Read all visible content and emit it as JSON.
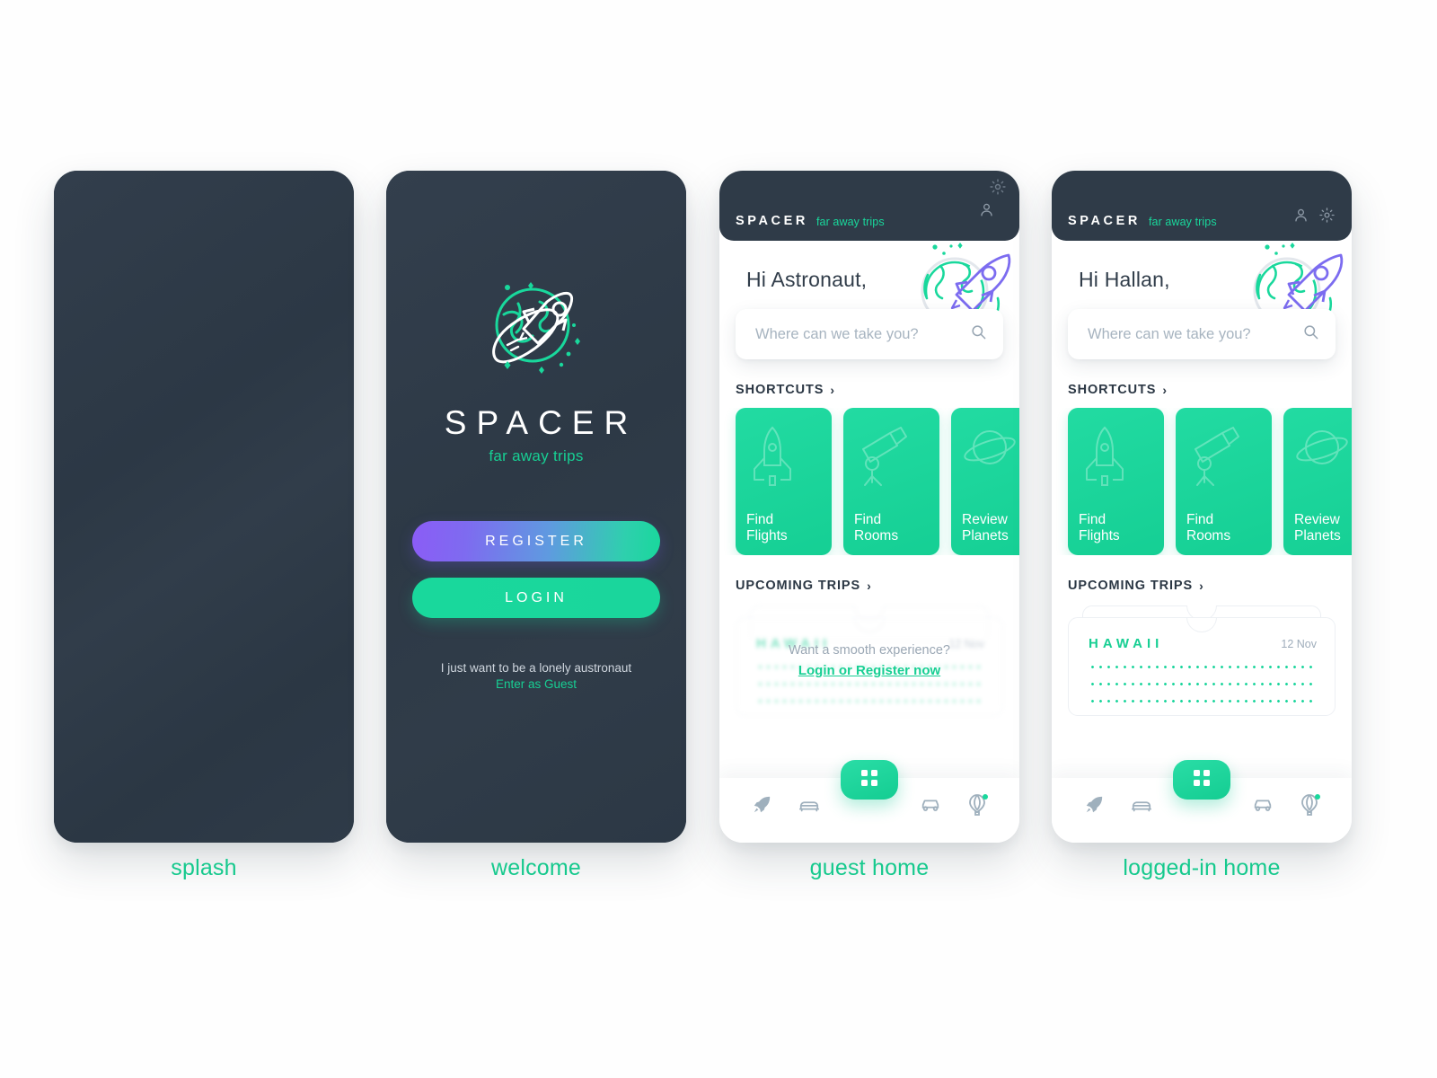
{
  "brand": {
    "name": "SPACER",
    "tagline": "far away trips"
  },
  "colors": {
    "accent_green": "#19d89c",
    "dark_navy": "#2f3b48",
    "purple": "#8b5cf6",
    "muted_text": "#a7b4c0",
    "caption_green": "#16c98d"
  },
  "captions": {
    "splash": "splash",
    "welcome": "welcome",
    "guest_home": "guest home",
    "logged_in_home": "logged-in home"
  },
  "welcome": {
    "logo_icon": "globe-rocket-logo-icon",
    "brand_name": "SPACER",
    "brand_sub": "far away trips",
    "register_label": "REGISTER",
    "login_label": "LOGIN",
    "guest_note_line1": "I just want to be a lonely austronaut",
    "guest_note_line2": "Enter as Guest"
  },
  "guest_home": {
    "app_bar": {
      "wordmark": "SPACER",
      "tagline": "far away trips",
      "person_icon": "person-icon",
      "gear_icon": "gear-icon"
    },
    "greeting": "Hi Astronaut,",
    "hero_icon": "globe-rocket-illustration-icon",
    "search": {
      "placeholder": "Where can we take you?",
      "value": "",
      "search_icon": "search-icon"
    },
    "shortcuts": {
      "title": "SHORTCUTS",
      "chevron": "›",
      "cards": [
        {
          "label": "Find\nFlights",
          "icon": "rocket-shuttle-icon"
        },
        {
          "label": "Find\nRooms",
          "icon": "telescope-icon"
        },
        {
          "label": "Review\nPlanets",
          "icon": "planet-icon"
        }
      ]
    },
    "upcoming_trips": {
      "title": "UPCOMING TRIPS",
      "chevron": "›",
      "hidden_destination": "HAWAII",
      "hidden_date": "12 Nov",
      "overlay_question": "Want a smooth experience?",
      "overlay_action": "Login or Register now"
    },
    "tabbar": {
      "items": [
        {
          "icon": "rocket-icon",
          "badge": false
        },
        {
          "icon": "bed-icon",
          "badge": false
        },
        {
          "icon": "grid-icon",
          "badge": false
        },
        {
          "icon": "car-icon",
          "badge": false
        },
        {
          "icon": "hot-air-balloon-icon",
          "badge": true
        }
      ]
    }
  },
  "logged_in_home": {
    "app_bar": {
      "wordmark": "SPACER",
      "tagline": "far away trips",
      "person_icon": "person-icon",
      "gear_icon": "gear-icon"
    },
    "greeting": "Hi Hallan,",
    "hero_icon": "globe-rocket-illustration-icon",
    "search": {
      "placeholder": "Where can we take you?",
      "value": "",
      "search_icon": "search-icon"
    },
    "shortcuts": {
      "title": "SHORTCUTS",
      "chevron": "›",
      "cards": [
        {
          "label": "Find\nFlights",
          "icon": "rocket-shuttle-icon"
        },
        {
          "label": "Find\nRooms",
          "icon": "telescope-icon"
        },
        {
          "label": "Review\nPlanets",
          "icon": "planet-icon"
        }
      ]
    },
    "upcoming_trips": {
      "title": "UPCOMING TRIPS",
      "chevron": "›",
      "destination": "HAWAII",
      "date": "12 Nov"
    },
    "tabbar": {
      "items": [
        {
          "icon": "rocket-icon",
          "badge": false
        },
        {
          "icon": "bed-icon",
          "badge": false
        },
        {
          "icon": "grid-icon",
          "badge": false
        },
        {
          "icon": "car-icon",
          "badge": false
        },
        {
          "icon": "hot-air-balloon-icon",
          "badge": true
        }
      ]
    }
  }
}
